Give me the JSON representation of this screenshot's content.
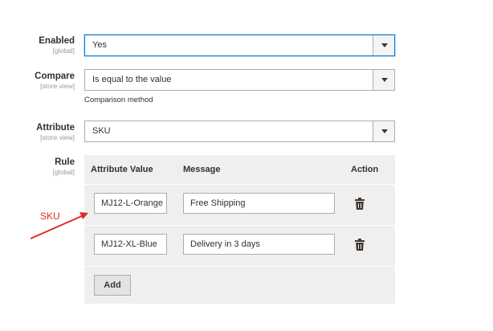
{
  "fields": {
    "enabled": {
      "label": "Enabled",
      "scope": "[global]",
      "value": "Yes"
    },
    "compare": {
      "label": "Compare",
      "scope": "[store view]",
      "value": "Is equal to the value",
      "note": "Comparison method"
    },
    "attribute": {
      "label": "Attribute",
      "scope": "[store view]",
      "value": "SKU"
    },
    "rule": {
      "label": "Rule",
      "scope": "[global]"
    }
  },
  "rule_table": {
    "headers": {
      "attribute_value": "Attribute Value",
      "message": "Message",
      "action": "Action"
    },
    "rows": [
      {
        "attribute_value": "MJ12-L-Orange",
        "message": "Free Shipping"
      },
      {
        "attribute_value": "MJ12-XL-Blue",
        "message": "Delivery in 3 days"
      }
    ],
    "add_label": "Add"
  },
  "annotation": {
    "label": "SKU",
    "color": "#e02b27"
  },
  "icons": {
    "delete": "trash-icon",
    "dropdown": "chevron-down-icon"
  },
  "colors": {
    "focus_border": "#007bdb",
    "table_bg": "#efefef"
  }
}
